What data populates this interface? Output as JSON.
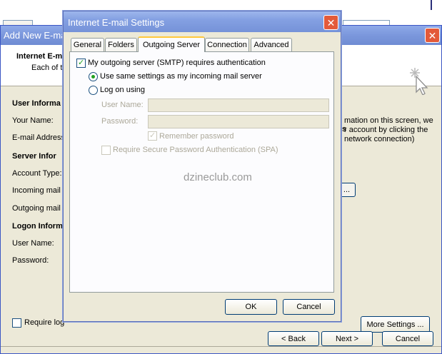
{
  "wizard": {
    "title": "Add New E-ma",
    "header_title": "Internet E-m",
    "header_subtitle": "Each of t",
    "sections": {
      "user_info": "User Informa",
      "server_info": "Server Infor",
      "logon_info": "Logon Inform"
    },
    "labels": {
      "your_name": "Your Name:",
      "email_address": "E-mail Address",
      "account_type": "Account Type:",
      "incoming_mail": "Incoming mail s",
      "outgoing_mail": "Outgoing mail s",
      "user_name": "User Name:",
      "password": "Password:"
    },
    "right_heading": "s",
    "right_text": [
      "mation on this screen, we",
      "r account by clicking the",
      "network connection)"
    ],
    "test_button_label": "...",
    "require_logon_label": "Require log",
    "more_settings_label": "More Settings ...",
    "back_label": "< Back",
    "next_label": "Next >",
    "cancel_label": "Cancel"
  },
  "dialog": {
    "title": "Internet E-mail Settings",
    "close_label": "X",
    "tabs": [
      {
        "label": "General",
        "active": false
      },
      {
        "label": "Folders",
        "active": false
      },
      {
        "label": "Outgoing Server",
        "active": true
      },
      {
        "label": "Connection",
        "active": false
      },
      {
        "label": "Advanced",
        "active": false
      }
    ],
    "smtp_auth_label": "My outgoing server (SMTP) requires authentication",
    "smtp_auth_checked": true,
    "same_settings_label": "Use same settings as my incoming mail server",
    "same_settings_selected": true,
    "log_on_label": "Log on using",
    "user_name_label": "User Name:",
    "user_name_value": "",
    "password_label": "Password:",
    "password_value": "",
    "remember_password_label": "Remember password",
    "remember_password_checked": true,
    "spa_label": "Require Secure Password Authentication (SPA)",
    "spa_checked": false,
    "watermark": "dzineclub.com",
    "ok_label": "OK",
    "cancel_label": "Cancel"
  },
  "colors": {
    "title_bar": "#7b97dc",
    "close_button": "#e35a3a",
    "dialog_face": "#ece9d8",
    "check_green": "#21a121",
    "active_tab_accent": "#ffc83c"
  }
}
